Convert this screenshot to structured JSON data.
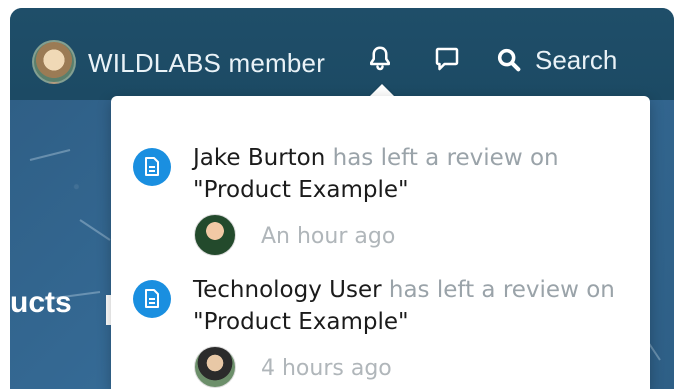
{
  "header": {
    "member_label": "WILDLABS member",
    "search_label": "Search",
    "icons": {
      "avatar": "user-avatar",
      "bell": "bell-icon",
      "chat": "chat-icon",
      "search": "search-icon"
    }
  },
  "background": {
    "side_text": "ucts"
  },
  "notifications": [
    {
      "user": "Jake Burton",
      "action": "has left a review on",
      "object": "\"Product Example\"",
      "time": "An hour ago",
      "icon": "document-icon"
    },
    {
      "user": "Technology User",
      "action": "has left a review on",
      "object": "\"Product Example\"",
      "time": "4 hours ago",
      "icon": "document-icon"
    }
  ],
  "colors": {
    "header_bg": "#1f4e69",
    "badge_blue": "#1a8fe0",
    "muted_text": "#9aa3a9"
  }
}
